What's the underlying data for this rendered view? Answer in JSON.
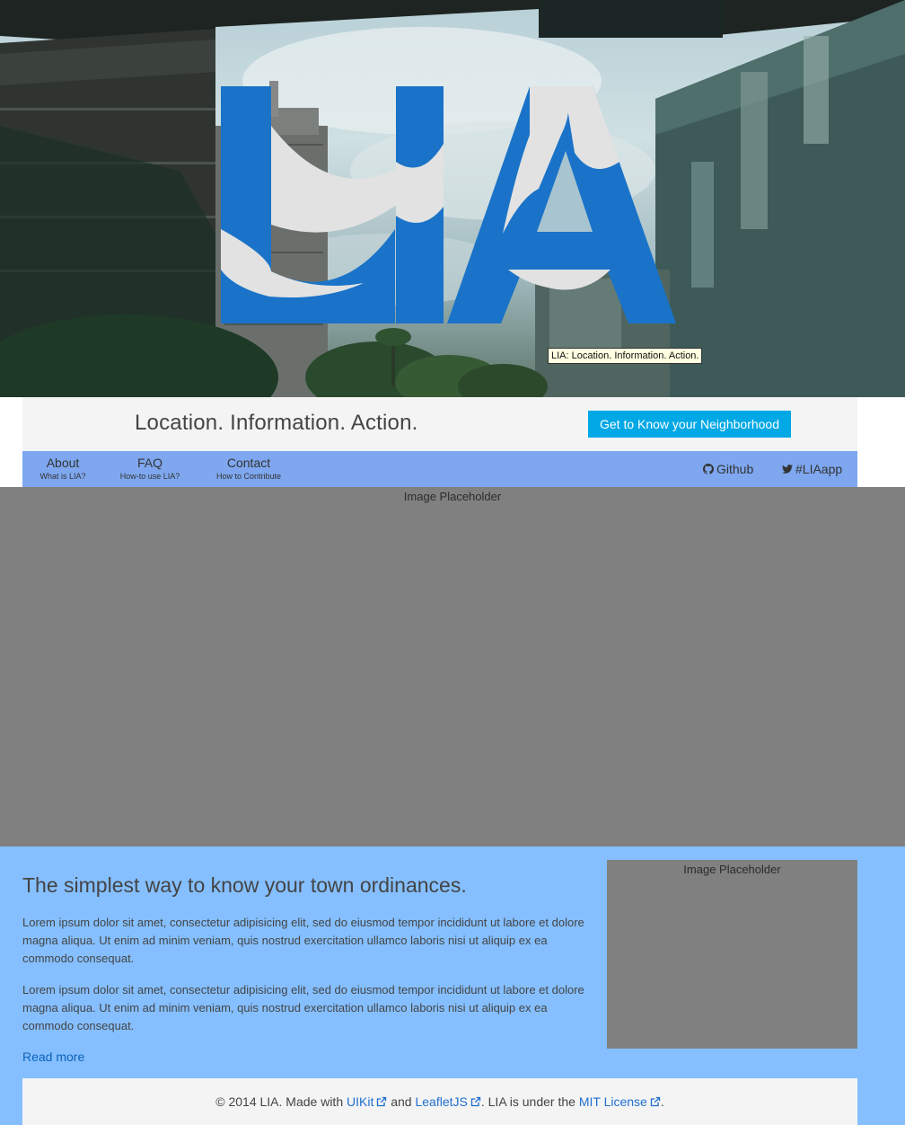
{
  "hero": {
    "logo_text": "LIA",
    "tooltip": "LIA: Location. Information. Action."
  },
  "tagbar": {
    "tagline": "Location. Information. Action.",
    "cta_label": "Get to Know your Neighborhood"
  },
  "nav": {
    "items": [
      {
        "label": "About",
        "sub": "What is LIA?"
      },
      {
        "label": "FAQ",
        "sub": "How-to use LIA?"
      },
      {
        "label": "Contact",
        "sub": "How to Contribute"
      }
    ],
    "github_label": "Github",
    "twitter_label": "#LIAapp",
    "github_icon": "github-icon",
    "twitter_icon": "twitter-icon"
  },
  "hero_placeholder": {
    "label": "Image Placeholder"
  },
  "content": {
    "heading": "The simplest way to know your town ordinances.",
    "paragraphs": [
      "Lorem ipsum dolor sit amet, consectetur adipisicing elit, sed do eiusmod tempor incididunt ut labore et dolore magna aliqua. Ut enim ad minim veniam, quis nostrud exercitation ullamco laboris nisi ut aliquip ex ea commodo consequat.",
      "Lorem ipsum dolor sit amet, consectetur adipisicing elit, sed do eiusmod tempor incididunt ut labore et dolore magna aliqua. Ut enim ad minim veniam, quis nostrud exercitation ullamco laboris nisi ut aliquip ex ea commodo consequat."
    ],
    "read_more": "Read more",
    "side_placeholder": "Image Placeholder"
  },
  "footer": {
    "prefix": "© 2014 LIA. Made with",
    "uikit": "UIKit",
    "and": "and",
    "leaflet": "LeafletJS",
    "license_text": ". LIA is under the",
    "mit": "MIT License",
    "suffix": ".",
    "external_icon": "external-link-icon"
  },
  "colors": {
    "logo_blue": "#1a73c8",
    "logo_grey": "#e2e2e2",
    "cta": "#00a8e6",
    "nav_bg": "#7ea7ef",
    "content_bg": "#85bfff",
    "placeholder": "#808080"
  }
}
